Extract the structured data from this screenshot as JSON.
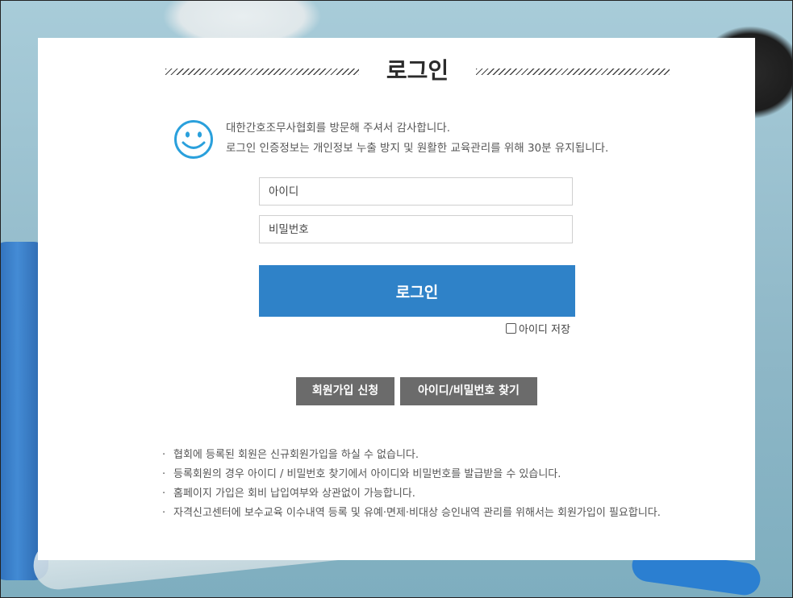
{
  "title": "로그인",
  "welcome": {
    "line1": "대한간호조무사협회를 방문해 주셔서 감사합니다.",
    "line2": "로그인 인증정보는 개인정보 누출 방지 및 원활한 교육관리를 위해 30분 유지됩니다."
  },
  "form": {
    "id_placeholder": "아이디",
    "pw_placeholder": "비밀번호",
    "login_label": "로그인",
    "save_id_label": "아이디 저장"
  },
  "buttons": {
    "join_label": "회원가입 신청",
    "find_label": "아이디/비밀번호 찾기"
  },
  "notes": [
    "협회에 등록된 회원은 신규회원가입을 하실 수 없습니다.",
    "등록회원의 경우 아이디 / 비밀번호 찾기에서 아이디와 비밀번호를 발급받을 수 있습니다.",
    "홈페이지 가입은 회비 납입여부와 상관없이 가능합니다.",
    "자격신고센터에 보수교육 이수내역 등록 및 유예·면제·비대상 승인내역 관리를 위해서는 회원가입이 필요합니다."
  ],
  "icons": {
    "welcome_icon": "smiley-face-icon"
  },
  "colors": {
    "accent": "#2f82c8",
    "secondary_button": "#6b6b6b"
  }
}
